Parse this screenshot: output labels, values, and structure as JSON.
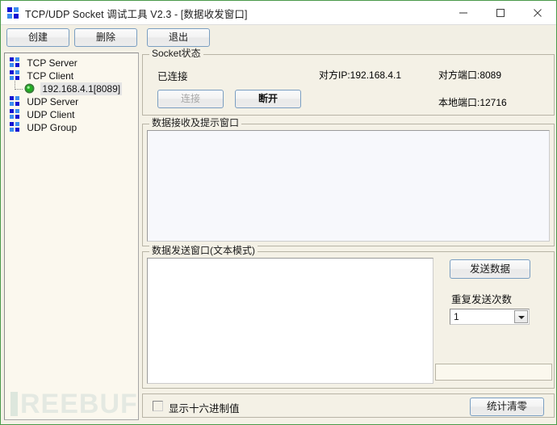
{
  "window": {
    "title": "TCP/UDP Socket 调试工具 V2.3 - [数据收发窗口]",
    "app_icon": "app-grid-icon",
    "controls": {
      "minimize": "minimize-icon",
      "maximize": "maximize-icon",
      "close": "close-icon"
    }
  },
  "toolbar": {
    "create_label": "创建",
    "delete_label": "删除",
    "exit_label": "退出"
  },
  "tree": {
    "items": [
      {
        "label": "TCP Server",
        "icon": "grid-icon",
        "level": 0,
        "selected": false
      },
      {
        "label": "TCP Client",
        "icon": "grid-icon",
        "level": 0,
        "selected": false
      },
      {
        "label": "192.168.4.1[8089]",
        "icon": "green-circle-icon",
        "level": 1,
        "selected": true
      },
      {
        "label": "UDP Server",
        "icon": "grid-icon",
        "level": 0,
        "selected": false
      },
      {
        "label": "UDP Client",
        "icon": "grid-icon",
        "level": 0,
        "selected": false
      },
      {
        "label": "UDP Group",
        "icon": "grid-icon",
        "level": 0,
        "selected": false
      }
    ]
  },
  "socket_status": {
    "group_title": "Socket状态",
    "state_text": "已连接",
    "connect_label": "连接",
    "disconnect_label": "断开",
    "peer_ip": "对方IP:192.168.4.1",
    "peer_port": "对方端口:8089",
    "local_port": "本地端口:12716"
  },
  "receive": {
    "group_title": "数据接收及提示窗口",
    "content": ""
  },
  "send": {
    "group_title": "数据发送窗口(文本模式)",
    "content": "",
    "send_button_label": "发送数据",
    "repeat_label": "重复发送次数",
    "repeat_value": "1",
    "repeat_options": [
      "1"
    ],
    "info_value": ""
  },
  "bottom": {
    "hex_checkbox_label": "显示十六进制值",
    "hex_checked": false,
    "clear_stats_label": "统计清零"
  },
  "watermark": {
    "text": "REEBUF"
  },
  "colors": {
    "window_border": "#4a9a4a",
    "panel_bg": "#f4f1e6",
    "tree_bg": "#fbf8ee",
    "receive_bg": "#f7f8fc",
    "send_bg": "#ffffff",
    "button_border": "#7a9ec1",
    "icon_blue": "#1414d2",
    "icon_light_blue": "#3c8cf0",
    "node_green": "#1f8b1f"
  }
}
